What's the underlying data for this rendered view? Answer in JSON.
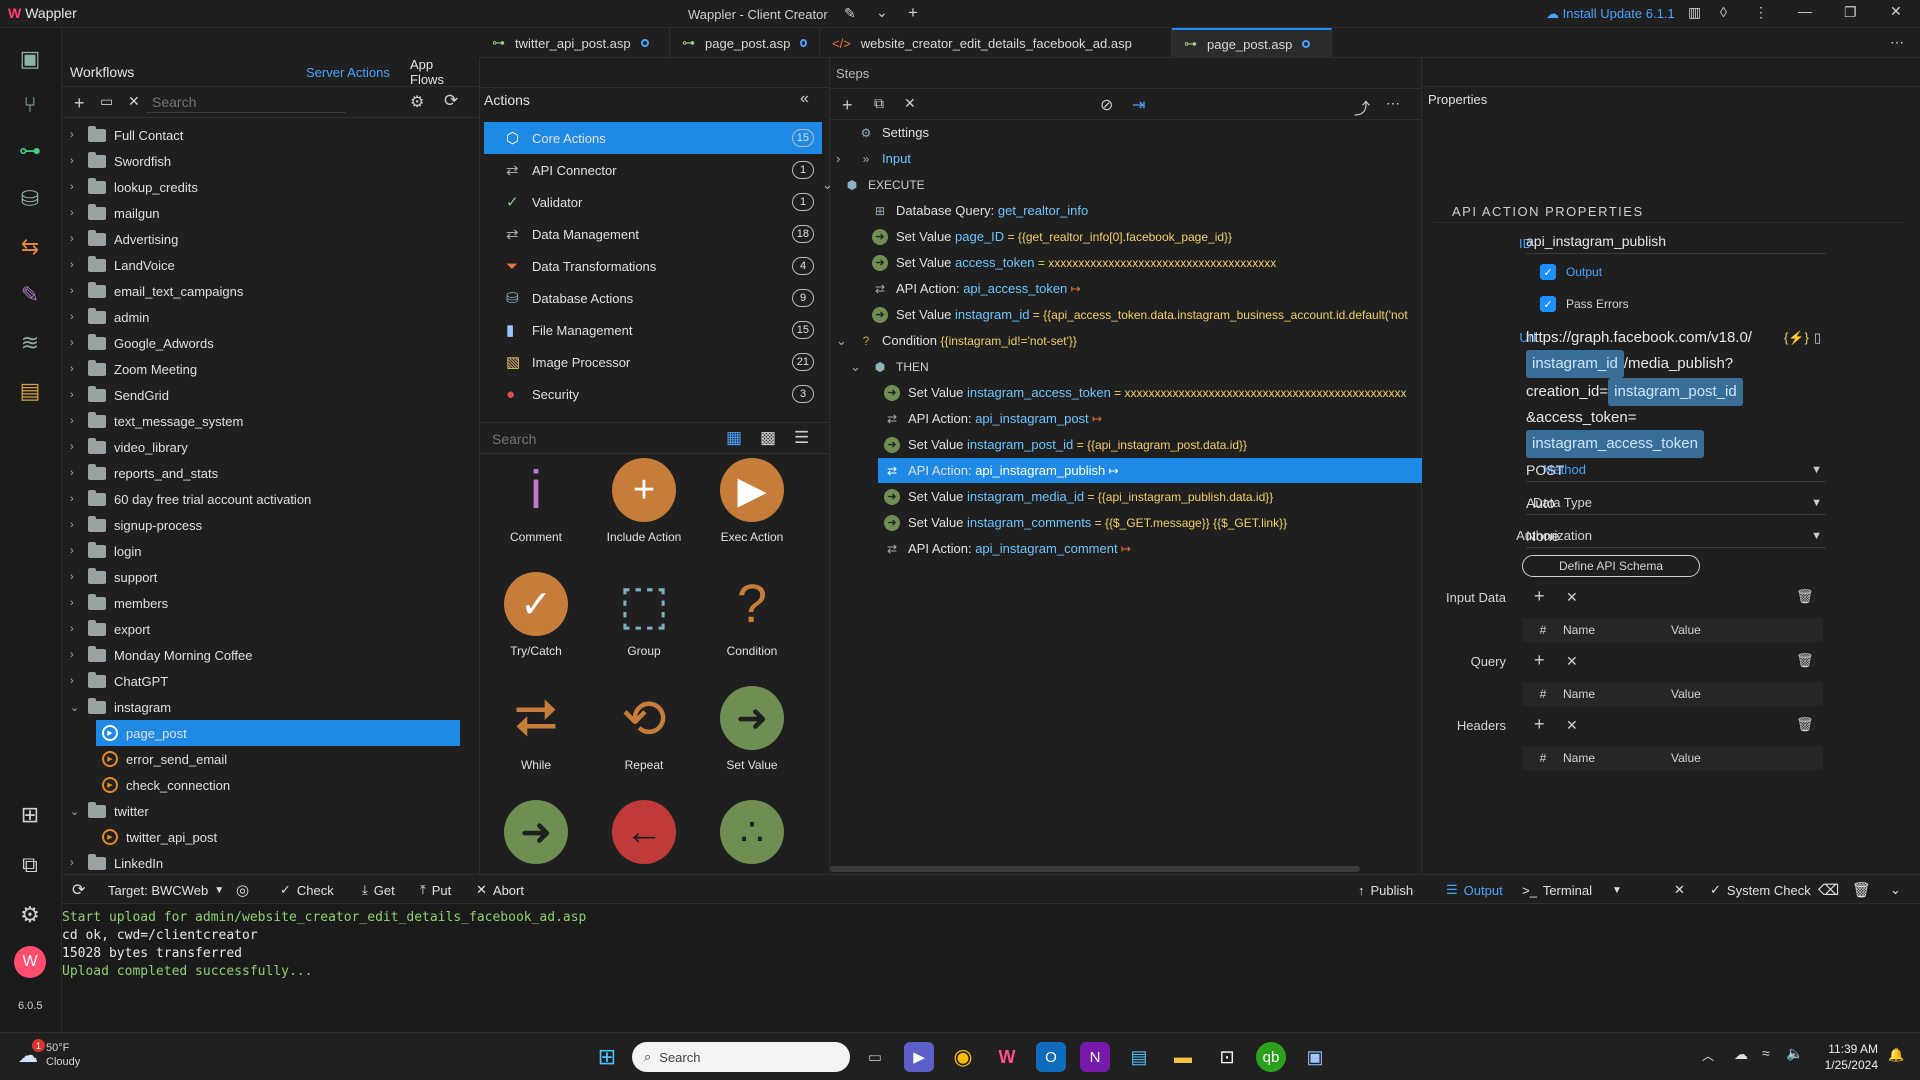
{
  "titlebar": {
    "app_name": "Wappler",
    "window_title": "Wappler - Client Creator",
    "install_update": "Install Update 6.1.1"
  },
  "rail": {
    "version": "6.0.5",
    "icons": [
      "pages-icon",
      "source-control-icon",
      "workflows-icon",
      "database-icon",
      "api-icon",
      "design-icon",
      "layers-icon",
      "clipboard-icon",
      "resources-icon",
      "extensions-icon",
      "settings-icon",
      "account-icon"
    ]
  },
  "tabs": [
    {
      "label": "twitter_api_post.asp"
    },
    {
      "label": "page_post.asp"
    },
    {
      "label": "website_creator_edit_details_facebook_ad.asp"
    },
    {
      "label": "page_post.asp"
    }
  ],
  "workflows": {
    "title": "Workflows",
    "server_actions": "Server Actions",
    "app_flows": "App Flows",
    "search_placeholder": "Search",
    "items": [
      {
        "label": "Full Contact",
        "type": "folder"
      },
      {
        "label": "Swordfish",
        "type": "folder"
      },
      {
        "label": "lookup_credits",
        "type": "folder"
      },
      {
        "label": "mailgun",
        "type": "folder"
      },
      {
        "label": "Advertising",
        "type": "folder"
      },
      {
        "label": "LandVoice",
        "type": "folder"
      },
      {
        "label": "email_text_campaigns",
        "type": "folder"
      },
      {
        "label": "admin",
        "type": "folder"
      },
      {
        "label": "Google_Adwords",
        "type": "folder"
      },
      {
        "label": "Zoom Meeting",
        "type": "folder"
      },
      {
        "label": "SendGrid",
        "type": "folder"
      },
      {
        "label": "text_message_system",
        "type": "folder"
      },
      {
        "label": "video_library",
        "type": "folder"
      },
      {
        "label": "reports_and_stats",
        "type": "folder"
      },
      {
        "label": "60 day free trial account activation",
        "type": "folder"
      },
      {
        "label": "signup-process",
        "type": "folder"
      },
      {
        "label": "login",
        "type": "folder"
      },
      {
        "label": "support",
        "type": "folder"
      },
      {
        "label": "members",
        "type": "folder"
      },
      {
        "label": "export",
        "type": "folder"
      },
      {
        "label": "Monday Morning Coffee",
        "type": "folder"
      },
      {
        "label": "ChatGPT",
        "type": "folder"
      },
      {
        "label": "instagram",
        "type": "folder-open"
      },
      {
        "label": "page_post",
        "type": "action-selected"
      },
      {
        "label": "error_send_email",
        "type": "action"
      },
      {
        "label": "check_connection",
        "type": "action"
      },
      {
        "label": "twitter",
        "type": "folder-open"
      },
      {
        "label": "twitter_api_post",
        "type": "action"
      },
      {
        "label": "LinkedIn",
        "type": "folder"
      }
    ]
  },
  "actions": {
    "title": "Actions",
    "search_placeholder": "Search",
    "categories": [
      {
        "label": "Core Actions",
        "count": "15"
      },
      {
        "label": "API Connector",
        "count": "1"
      },
      {
        "label": "Validator",
        "count": "1"
      },
      {
        "label": "Data Management",
        "count": "18"
      },
      {
        "label": "Data Transformations",
        "count": "4"
      },
      {
        "label": "Database Actions",
        "count": "9"
      },
      {
        "label": "File Management",
        "count": "15"
      },
      {
        "label": "Image Processor",
        "count": "21"
      },
      {
        "label": "Security",
        "count": "3"
      }
    ],
    "tiles": [
      {
        "label": "Comment"
      },
      {
        "label": "Include Action"
      },
      {
        "label": "Exec Action"
      },
      {
        "label": "Try/Catch"
      },
      {
        "label": "Group"
      },
      {
        "label": "Condition"
      },
      {
        "label": "While"
      },
      {
        "label": "Repeat"
      },
      {
        "label": "Set Value"
      }
    ]
  },
  "steps": {
    "title": "Steps",
    "rows": [
      {
        "pre": "Settings",
        "link": "",
        "expr": ""
      },
      {
        "pre": "Input",
        "link": "",
        "expr": ""
      },
      {
        "pre": "EXECUTE",
        "link": "",
        "expr": ""
      },
      {
        "pre": "Database Query: ",
        "link": "get_realtor_info",
        "expr": ""
      },
      {
        "pre": "Set Value ",
        "link": "page_ID",
        "expr": " = {{get_realtor_info[0].facebook_page_id}}"
      },
      {
        "pre": "Set Value ",
        "link": "access_token",
        "expr": " = xxxxxxxxxxxxxxxxxxxxxxxxxxxxxxxxxxxxxx"
      },
      {
        "pre": "API Action: ",
        "link": "api_access_token",
        "expr": " ↦"
      },
      {
        "pre": "Set Value ",
        "link": "instagram_id",
        "expr": " = {{api_access_token.data.instagram_business_account.id.default('not"
      },
      {
        "pre": "Condition ",
        "link": "",
        "expr": "{{instagram_id!='not-set'}}"
      },
      {
        "pre": "THEN",
        "link": "",
        "expr": ""
      },
      {
        "pre": "Set Value ",
        "link": "instagram_access_token",
        "expr": " = xxxxxxxxxxxxxxxxxxxxxxxxxxxxxxxxxxxxxxxxxxxxxxx"
      },
      {
        "pre": "API Action: ",
        "link": "api_instagram_post",
        "expr": " ↦"
      },
      {
        "pre": "Set Value ",
        "link": "instagram_post_id",
        "expr": " = {{api_instagram_post.data.id}}"
      },
      {
        "pre": "API Action: ",
        "link": "api_instagram_publish",
        "expr": " ↦"
      },
      {
        "pre": "Set Value ",
        "link": "instagram_media_id",
        "expr": " = {{api_instagram_publish.data.id}}"
      },
      {
        "pre": "Set Value ",
        "link": "instagram_comments",
        "expr": " = {{$_GET.message}} {{$_GET.link}}"
      },
      {
        "pre": "API Action: ",
        "link": "api_instagram_comment",
        "expr": " ↦"
      }
    ]
  },
  "properties": {
    "title": "Properties",
    "section": "API ACTION PROPERTIES",
    "id_label": "ID",
    "id_value": "api_instagram_publish",
    "output_label": "Output",
    "pass_errors_label": "Pass Errors",
    "url_label": "Url",
    "url_part1": "https://graph.facebook.com/v18.0/",
    "url_pill1": "instagram_id",
    "url_part2": "/media_publish?",
    "url_part3": "creation_id=",
    "url_pill2": "instagram_post_id",
    "url_part4": "&access_token=",
    "url_pill3": "instagram_access_token",
    "method_label": "Method",
    "method_value": "POST",
    "data_type_label": "Data Type",
    "data_type_value": "Auto",
    "auth_label": "Authorization",
    "auth_value": "None",
    "define_schema": "Define API Schema",
    "input_data_label": "Input Data",
    "query_label": "Query",
    "headers_label": "Headers",
    "col_hash": "#",
    "col_name": "Name",
    "col_value": "Value"
  },
  "bottombar": {
    "target": "Target: BWCWeb",
    "check": "Check",
    "get": "Get",
    "put": "Put",
    "abort": "Abort",
    "publish": "Publish",
    "output": "Output",
    "terminal": "Terminal",
    "system_check": "System Check"
  },
  "console": {
    "lines": [
      "Start upload for admin/website_creator_edit_details_facebook_ad.asp",
      "cd ok, cwd=/clientcreator",
      "15028 bytes transferred",
      "Upload completed successfully..."
    ]
  },
  "taskbar": {
    "weather_temp": "50°F",
    "weather_desc": "Cloudy",
    "weather_badge": "1",
    "search_placeholder": "Search",
    "time": "11:39 AM",
    "date": "1/25/2024"
  },
  "colors": {
    "accent": "#1e8ae6",
    "link": "#6ec5ff",
    "expr": "#f0d068",
    "console_green": "#8fd16f"
  }
}
